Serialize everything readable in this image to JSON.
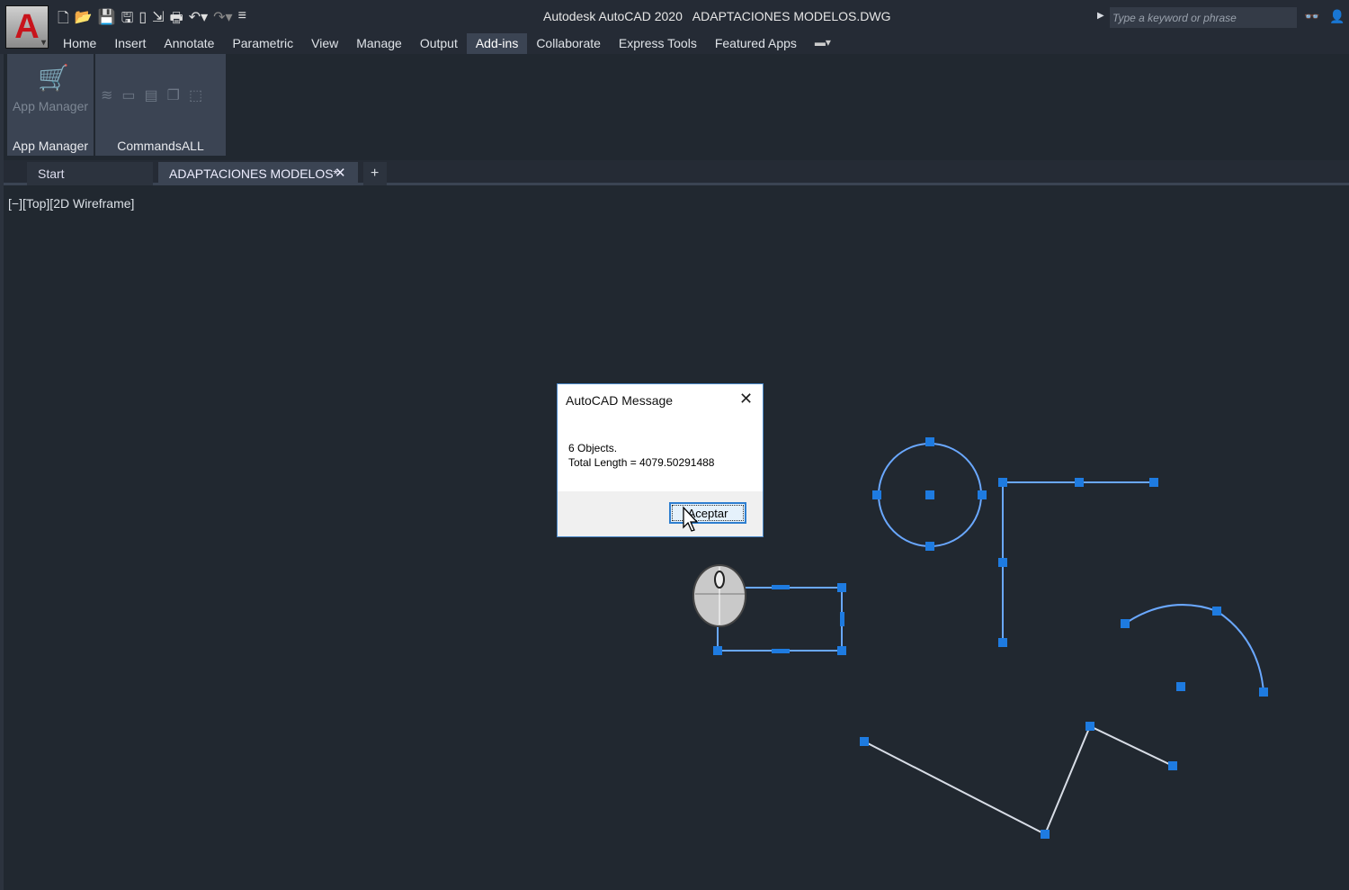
{
  "app": {
    "title": "Autodesk AutoCAD 2020",
    "file": "ADAPTACIONES MODELOS.DWG",
    "logo": "A"
  },
  "quick_access": [
    "new-icon",
    "open-icon",
    "save-icon",
    "save-as-icon",
    "web-mobile-icon",
    "share-icon",
    "plot-icon",
    "undo-icon",
    "redo-icon",
    "customize-icon"
  ],
  "search": {
    "placeholder": "Type a keyword or phrase"
  },
  "menu": {
    "tabs": [
      "Home",
      "Insert",
      "Annotate",
      "Parametric",
      "View",
      "Manage",
      "Output",
      "Add-ins",
      "Collaborate",
      "Express Tools",
      "Featured Apps"
    ],
    "active": "Add-ins"
  },
  "ribbon": {
    "panels": [
      {
        "label": "App Manager",
        "button": "App Manager"
      },
      {
        "label": "CommandsALL"
      }
    ]
  },
  "doc_tabs": {
    "start": "Start",
    "active": "ADAPTACIONES MODELOS*"
  },
  "viewport": {
    "label": "[−][Top][2D Wireframe]"
  },
  "dialog": {
    "title": "AutoCAD Message",
    "line1": "6 Objects.",
    "line2": "Total Length = 4079.50291488",
    "button": "Aceptar"
  },
  "colors": {
    "background": "#212830",
    "grip": "#1e7be0",
    "selection": "#6aa8ff",
    "ribbon_panel": "#3b4453"
  }
}
